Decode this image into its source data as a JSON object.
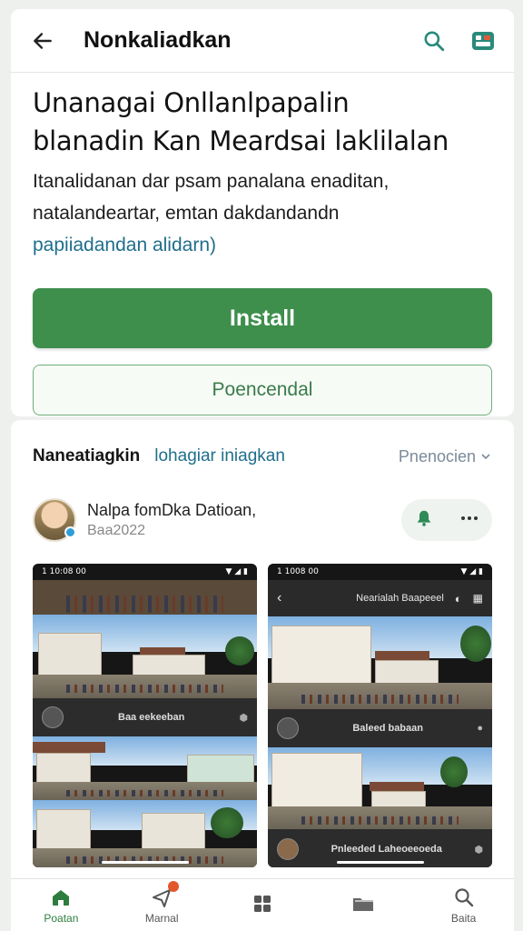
{
  "header": {
    "title": "Nonkaliadkan",
    "back_icon": "arrow-left-icon",
    "search_icon": "search-icon",
    "store_icon": "app-grid-icon"
  },
  "intro": {
    "title_line1": "Unanagai Onllanlpapalin",
    "title_line2": "blanadin Kan Meardsai laklilalan",
    "desc_line1": "Itanalidanan dar psam panalana enaditan,",
    "desc_line2": "natalandeartar, emtan dakdandandn",
    "link_text": "papiiadandan alidarn)",
    "install_label": "Install",
    "secondary_label": "Poencendal"
  },
  "reviews": {
    "section_title": "Naneatiagkin",
    "section_link": "lohagiar iniagkan",
    "sort_label": "Pnenocien",
    "author_name": "Nalpa fomDka Datioan,",
    "author_date": "Baa2022"
  },
  "screens": [
    {
      "status_time": "1 10:08 00",
      "media_label": "Baa eekeeban"
    },
    {
      "status_time": "1 1008 00",
      "bar_title": "Nearialah Baapeeel",
      "media_label": "Baleed babaan",
      "footer_label": "Pnleeded Laheoeeoeda"
    }
  ],
  "bottom_nav": [
    {
      "label": "Poatan",
      "icon": "home-icon",
      "active": true
    },
    {
      "label": "Marnal",
      "icon": "send-icon",
      "active": false
    },
    {
      "label": "",
      "icon": "apps-icon",
      "active": false
    },
    {
      "label": "",
      "icon": "folder-icon",
      "active": false
    },
    {
      "label": "Baita",
      "icon": "search-icon",
      "active": false
    }
  ],
  "colors": {
    "accent_green": "#3e8e4c",
    "link_blue": "#1f6e8c",
    "badge_orange": "#e2572b"
  }
}
